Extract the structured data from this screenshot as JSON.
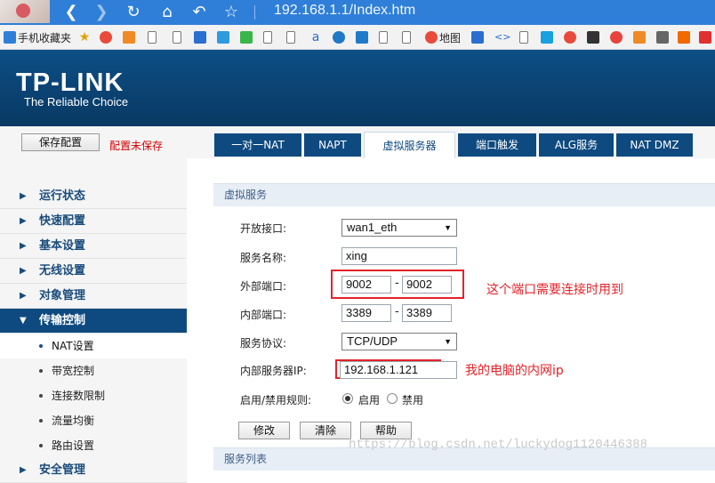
{
  "browser": {
    "url": "192.168.1.1/Index.htm",
    "nav_icons": [
      "back-icon",
      "forward-icon",
      "refresh-icon",
      "home-icon",
      "undo-icon",
      "star-icon"
    ]
  },
  "bookmarks": {
    "mobile_favorites": "手机收藏夹",
    "map": "地图"
  },
  "header": {
    "logo": "TP-LINK",
    "slogan": "The Reliable Choice"
  },
  "left": {
    "save_button": "保存配置",
    "unsaved_text": "配置未保存",
    "menu": [
      {
        "label": "运行状态"
      },
      {
        "label": "快速配置"
      },
      {
        "label": "基本设置"
      },
      {
        "label": "无线设置"
      },
      {
        "label": "对象管理"
      },
      {
        "label": "传输控制"
      }
    ],
    "submenu": [
      {
        "label": "NAT设置"
      },
      {
        "label": "带宽控制"
      },
      {
        "label": "连接数限制"
      },
      {
        "label": "流量均衡"
      },
      {
        "label": "路由设置"
      }
    ],
    "next_menu": "安全管理"
  },
  "tabs": [
    {
      "label": "一对一NAT"
    },
    {
      "label": "NAPT"
    },
    {
      "label": "虚拟服务器"
    },
    {
      "label": "端口触发"
    },
    {
      "label": "ALG服务"
    },
    {
      "label": "NAT DMZ"
    }
  ],
  "form": {
    "section_title": "虚拟服务",
    "open_interface_label": "开放接口:",
    "open_interface_value": "wan1_eth",
    "service_name_label": "服务名称:",
    "service_name_value": "xing",
    "external_port_label": "外部端口:",
    "external_port_start": "9002",
    "external_port_end": "9002",
    "internal_port_label": "内部端口:",
    "internal_port_start": "3389",
    "internal_port_end": "3389",
    "protocol_label": "服务协议:",
    "protocol_value": "TCP/UDP",
    "internal_ip_label": "内部服务器IP:",
    "internal_ip_value": "192.168.1.121",
    "rule_label": "启用/禁用规则:",
    "enable_label": "启用",
    "disable_label": "禁用",
    "modify_button": "修改",
    "clear_button": "清除",
    "help_button": "帮助",
    "list_section_title": "服务列表",
    "range_separator": "-"
  },
  "annotations": {
    "port_note": "这个端口需要连接时用到",
    "ip_note": "我的电脑的内网ip"
  },
  "watermark": "https://blog.csdn.net/luckydog1120446388"
}
